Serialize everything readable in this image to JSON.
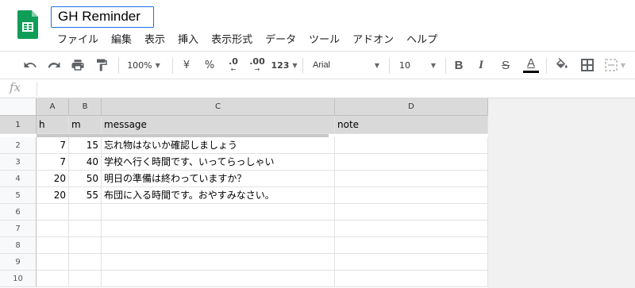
{
  "doc": {
    "title": "GH Reminder"
  },
  "menu": [
    "ファイル",
    "編集",
    "表示",
    "挿入",
    "表示形式",
    "データ",
    "ツール",
    "アドオン",
    "ヘルプ"
  ],
  "toolbar": {
    "zoom": "100%",
    "currency": "¥",
    "percent": "%",
    "dec_dec": ".0",
    "dec_inc": ".00",
    "more_formats": "123",
    "font": "Arial",
    "font_size": "10",
    "bold": "B",
    "italic": "I",
    "strike": "S",
    "text_color": "A",
    "text_color_value": "#000000"
  },
  "formula_bar": {
    "fx": "fx",
    "value": ""
  },
  "grid": {
    "columns": [
      "A",
      "B",
      "C",
      "D"
    ],
    "rows": [
      "1",
      "2",
      "3",
      "4",
      "5",
      "6",
      "7",
      "8",
      "9",
      "10"
    ],
    "header_row": [
      "h",
      "m",
      "message",
      "note"
    ],
    "data": [
      [
        "7",
        "15",
        "忘れ物はないか確認しましょう",
        ""
      ],
      [
        "7",
        "40",
        "学校へ行く時間です、いってらっしゃい",
        ""
      ],
      [
        "20",
        "50",
        "明日の準備は終わっていますか？",
        ""
      ],
      [
        "20",
        "55",
        "布団に入る時間です。おやすみなさい。",
        ""
      ]
    ]
  },
  "colors": {
    "accent": "#1a73e8",
    "logo_green": "#0f9d58"
  }
}
